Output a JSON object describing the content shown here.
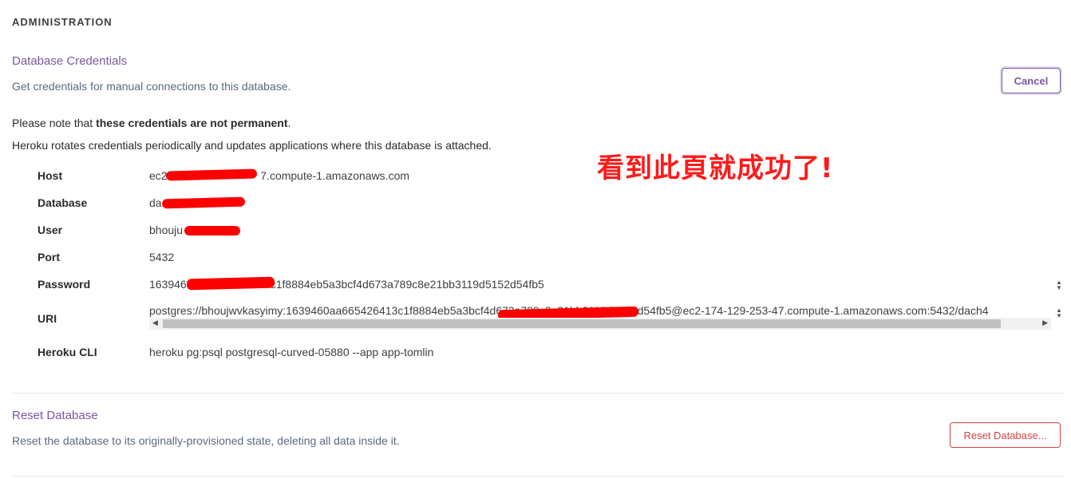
{
  "section_heading": "ADMINISTRATION",
  "credentials": {
    "title": "Database Credentials",
    "description": "Get credentials for manual connections to this database.",
    "cancel_label": "Cancel",
    "note_prefix": "Please note that ",
    "note_bold": "these credentials are not permanent",
    "note_suffix": ".",
    "rotation_note": "Heroku rotates credentials periodically and updates applications where this database is attached.",
    "rows": [
      {
        "label": "Host",
        "value": "ec2                              7.compute-1.amazonaws.com"
      },
      {
        "label": "Database",
        "value": "da"
      },
      {
        "label": "User",
        "value": "bhouju"
      },
      {
        "label": "Port",
        "value": "5432"
      },
      {
        "label": "Password",
        "value": "163946                           c1f8884eb5a3bcf4d673a789c8e21bb3119d5152d54fb5"
      },
      {
        "label": "URI",
        "value": "postgres://bhoujwvkasyimy:1639460aa665426413c1f8884eb5a3bcf4d673a789c8e21bb3119d5152d54fb5@ec2-174-129-253-47.compute-1.amazonaws.com:5432/dach4"
      },
      {
        "label": "Heroku CLI",
        "value": "heroku pg:psql postgresql-curved-05880 --app app-tomlin"
      }
    ]
  },
  "annotation": "看到此頁就成功了!",
  "reset": {
    "title": "Reset Database",
    "description": "Reset the database to its originally-provisioned state, deleting all data inside it.",
    "button_label": "Reset Database..."
  },
  "colors": {
    "accent": "#79589f",
    "danger": "#d64242",
    "annotation": "#ff1a1a"
  }
}
